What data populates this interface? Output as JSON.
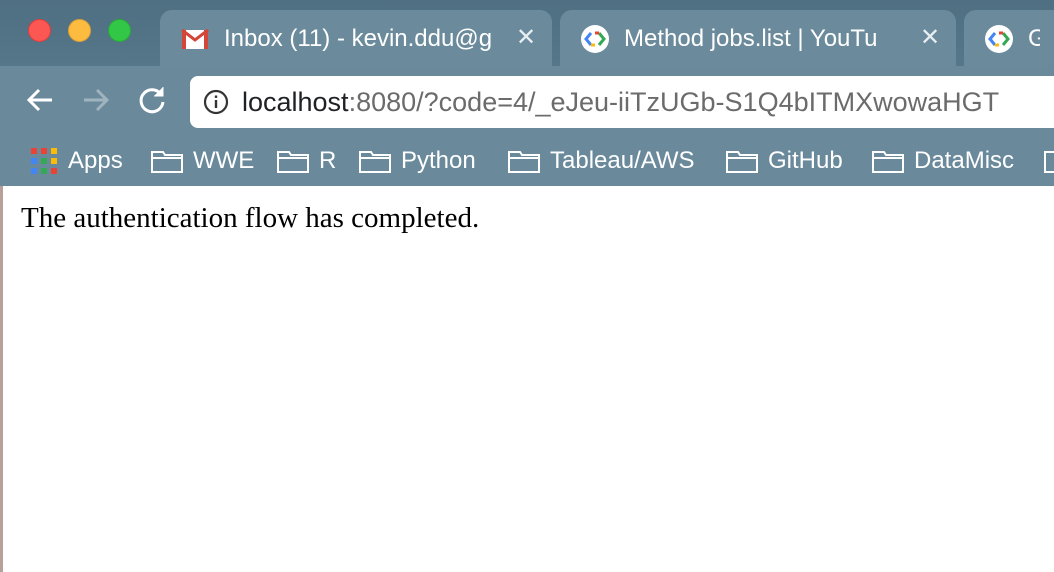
{
  "window": {
    "controls": [
      "close",
      "minimize",
      "zoom"
    ]
  },
  "tabs": [
    {
      "icon": "gmail-icon",
      "title": "Inbox (11) - kevin.ddu@g",
      "title_fade": ""
    },
    {
      "icon": "google-api-icon",
      "title": "Method jobs.list  |  YouTu",
      "title_fade": ""
    },
    {
      "icon": "google-api-icon",
      "title": "Get",
      "title_fade": ""
    }
  ],
  "toolbar": {
    "url_host": "localhost",
    "url_path": ":8080/?code=4/_eJeu-iiTzUGb-S1Q4bITMXwowaHGT"
  },
  "bookmarks": [
    {
      "label": "Apps",
      "icon": "apps-grid-icon"
    },
    {
      "label": "WWE",
      "icon": "folder-icon"
    },
    {
      "label": "R",
      "icon": "folder-icon"
    },
    {
      "label": "Python",
      "icon": "folder-icon"
    },
    {
      "label": "Tableau/AWS",
      "icon": "folder-icon"
    },
    {
      "label": "GitHub",
      "icon": "folder-icon"
    },
    {
      "label": "DataMisc",
      "icon": "folder-icon"
    }
  ],
  "page": {
    "message": "The authentication flow has completed."
  },
  "colors": {
    "chrome": "#6a8a9c",
    "titlebar": "#557789",
    "close": "#fc5753",
    "minimize": "#fdbc40",
    "zoom": "#33c748"
  }
}
